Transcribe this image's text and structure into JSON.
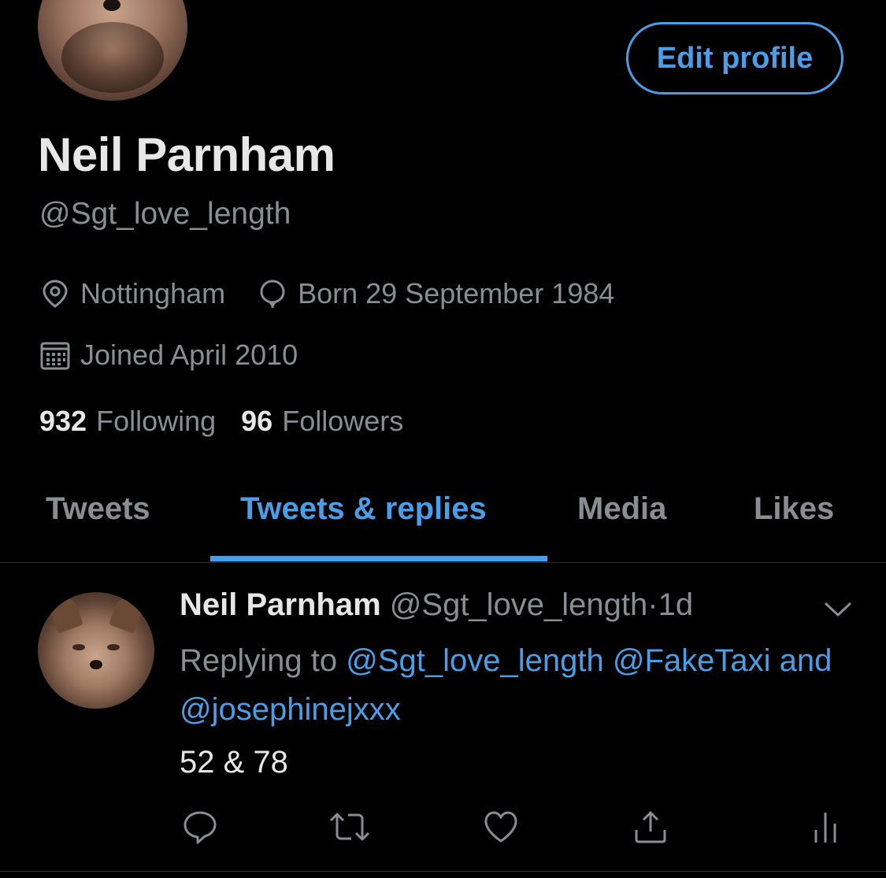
{
  "profile": {
    "display_name": "Neil Parnham",
    "handle": "@Sgt_love_length",
    "edit_button_label": "Edit profile",
    "location": "Nottingham",
    "birthday": "Born 29 September 1984",
    "joined": "Joined April 2010",
    "following_count": "932",
    "following_label": "Following",
    "followers_count": "96",
    "followers_label": "Followers"
  },
  "tabs": [
    {
      "label": "Tweets",
      "active": false
    },
    {
      "label": "Tweets & replies",
      "active": true
    },
    {
      "label": "Media",
      "active": false
    },
    {
      "label": "Likes",
      "active": false
    }
  ],
  "tweet": {
    "author": "Neil Parnham",
    "handle": "@Sgt_love_length",
    "separator": "·",
    "time": "1d",
    "replying_prefix": "Replying to",
    "mention_1": "@Sgt_love_length",
    "mention_2": "@FakeTaxi",
    "and_word": "and",
    "mention_3": "@josephinejxxx",
    "text": "52 & 78"
  },
  "icons": {
    "location": "location-pin-icon",
    "birthday": "balloon-icon",
    "joined": "calendar-icon",
    "caret": "chevron-down-icon",
    "reply": "reply-bubble-icon",
    "retweet": "retweet-icon",
    "like": "heart-icon",
    "share": "share-icon",
    "analytics": "analytics-icon"
  },
  "colors": {
    "background": "#000000",
    "accent": "#4a9ee8",
    "primary_text": "#e7e7e7",
    "secondary_text": "#8a8d91",
    "divider": "#2f3336"
  }
}
